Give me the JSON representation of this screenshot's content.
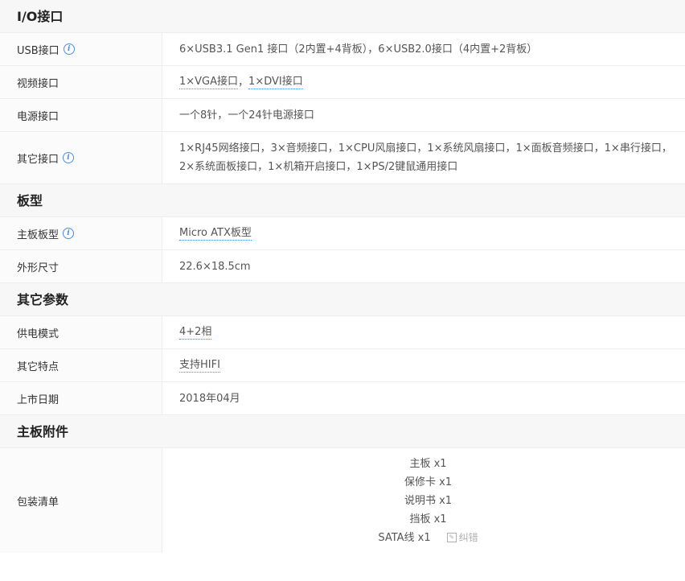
{
  "sections": {
    "io": {
      "title": "I/O接口",
      "usb_label": "USB接口",
      "usb_value": "6×USB3.1 Gen1 接口（2内置+4背板），6×USB2.0接口（4内置+2背板）",
      "video_label": "视频接口",
      "video_link1": "1×VGA接口",
      "video_sep": "，",
      "video_link2": "1×DVI接口",
      "power_label": "电源接口",
      "power_value": "一个8针，一个24针电源接口",
      "other_label": "其它接口",
      "other_value": "1×RJ45网络接口，3×音频接口，1×CPU风扇接口，1×系统风扇接口，1×面板音频接口，1×串行接口，2×系统面板接口，1×机箱开启接口，1×PS/2键鼠通用接口"
    },
    "board": {
      "title": "板型",
      "type_label": "主板板型",
      "type_value": "Micro ATX板型",
      "size_label": "外形尺寸",
      "size_value": "22.6×18.5cm"
    },
    "other": {
      "title": "其它参数",
      "power_mode_label": "供电模式",
      "power_mode_value": "4+2相",
      "features_label": "其它特点",
      "features_value": "支持HIFI",
      "release_label": "上市日期",
      "release_value": "2018年04月"
    },
    "accessories": {
      "title": "主板附件",
      "package_label": "包装清单",
      "items": [
        "主板 x1",
        "保修卡 x1",
        "说明书 x1",
        "挡板 x1",
        "SATA线 x1"
      ],
      "fix_label": "纠错"
    }
  },
  "icons": {
    "info": "info-icon",
    "edit": "edit-icon"
  },
  "colors": {
    "accent": "#4a90e2",
    "header_bg": "#f7f7f7",
    "border": "#ededed"
  }
}
